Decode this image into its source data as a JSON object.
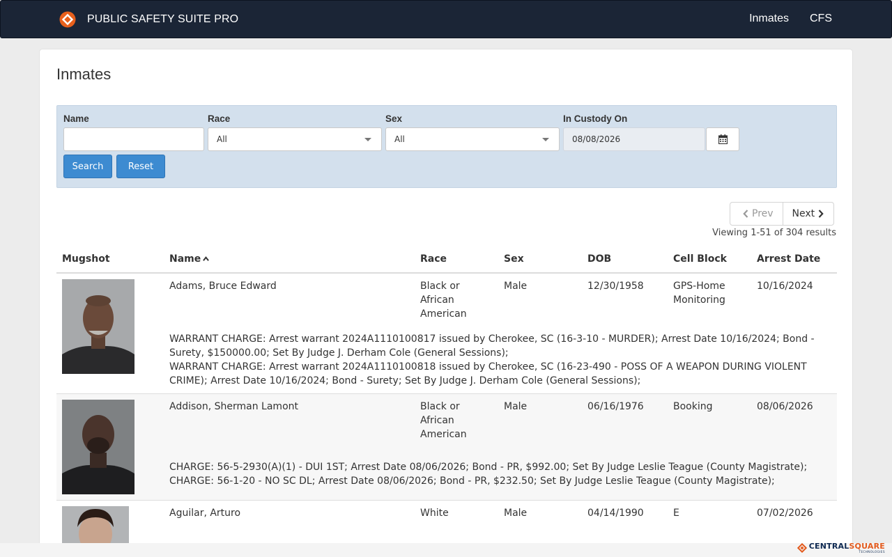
{
  "app": {
    "name": "PUBLIC SAFETY SUITE PRO"
  },
  "nav": {
    "links": [
      {
        "label": "Inmates"
      },
      {
        "label": "CFS"
      }
    ]
  },
  "page": {
    "title": "Inmates"
  },
  "filters": {
    "name": {
      "label": "Name",
      "value": ""
    },
    "race": {
      "label": "Race",
      "value": "All"
    },
    "sex": {
      "label": "Sex",
      "value": "All"
    },
    "custody": {
      "label": "In Custody On",
      "value": "08/08/2026"
    },
    "search_label": "Search",
    "reset_label": "Reset"
  },
  "pagination": {
    "prev_label": "Prev",
    "next_label": "Next",
    "summary": "Viewing 1-51 of 304 results"
  },
  "table": {
    "columns": [
      "Mugshot",
      "Name",
      "Race",
      "Sex",
      "DOB",
      "Cell Block",
      "Arrest Date"
    ],
    "sort": {
      "column": "Name",
      "direction": "ascending"
    },
    "rows": [
      {
        "name": "Adams, Bruce Edward",
        "race": [
          "Black or",
          "African",
          "American"
        ],
        "sex": "Male",
        "dob": "12/30/1958",
        "cell_block": [
          "GPS-Home",
          "Monitoring"
        ],
        "arrest_date": "10/16/2024",
        "charges": [
          [
            "WARRANT CHARGE: Arrest warrant 2024A1110100817 issued by Cherokee, SC (16-3-10 - MURDER); Arrest Date 10/16/2024; Bond -",
            "Surety, $150000.00; Set By Judge J. Derham Cole (General Sessions);"
          ],
          [
            "WARRANT CHARGE: Arrest warrant 2024A1110100818 issued by Cherokee, SC (16-23-490 - POSS OF A WEAPON DURING VIOLENT",
            "CRIME); Arrest Date 10/16/2024; Bond - Surety; Set By Judge J. Derham Cole (General Sessions);"
          ]
        ]
      },
      {
        "name": "Addison, Sherman Lamont",
        "race": [
          "Black or",
          "African",
          "American"
        ],
        "sex": "Male",
        "dob": "06/16/1976",
        "cell_block": [
          "Booking"
        ],
        "arrest_date": "08/06/2026",
        "charges": [
          [
            "CHARGE: 56-5-2930(A)(1) - DUI 1ST; Arrest Date 08/06/2026; Bond - PR, $992.00; Set By Judge Leslie Teague (County Magistrate);"
          ],
          [
            "CHARGE: 56-1-20 - NO SC DL; Arrest Date 08/06/2026; Bond - PR, $232.50; Set By Judge Leslie Teague (County Magistrate);"
          ]
        ]
      },
      {
        "name": "Aguilar, Arturo",
        "race": [
          "White"
        ],
        "sex": "Male",
        "dob": "04/14/1990",
        "cell_block": [
          "E"
        ],
        "arrest_date": "07/02/2026",
        "charges": []
      }
    ]
  },
  "footer": {
    "brand_central": "CENTRAL",
    "brand_square": "SQUARE",
    "tagline": "TECHNOLOGIES"
  },
  "colors": {
    "navbar": "#1b2536",
    "accent_orange": "#e8601c",
    "button_blue": "#3d8bd1",
    "filter_bg": "#d3e0ed"
  },
  "icons": [
    "brand-logo",
    "calendar-icon",
    "chevron-left-icon",
    "chevron-right-icon",
    "sort-asc-icon",
    "centralsquare-logo"
  ]
}
